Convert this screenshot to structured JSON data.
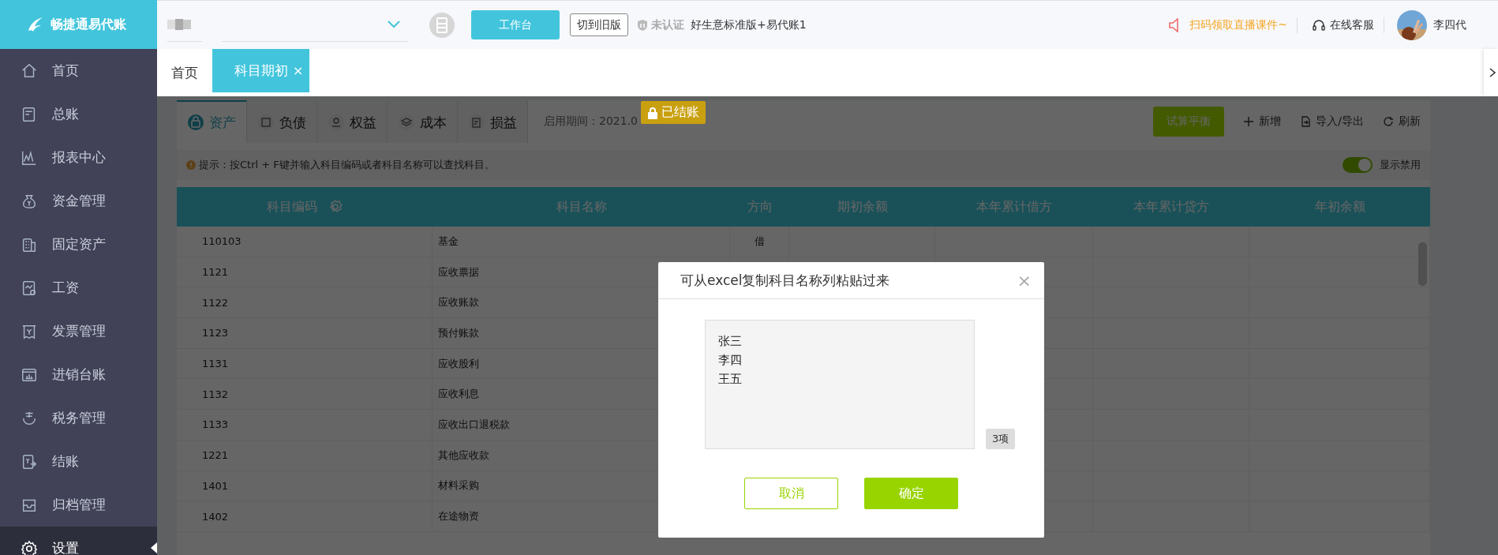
{
  "sidebar": {
    "logo": "畅捷通易代账",
    "items": [
      {
        "label": "首页",
        "selected": false
      },
      {
        "label": "总账",
        "selected": false
      },
      {
        "label": "报表中心",
        "selected": false
      },
      {
        "label": "资金管理",
        "selected": false
      },
      {
        "label": "固定资产",
        "selected": false
      },
      {
        "label": "工资",
        "selected": false
      },
      {
        "label": "发票管理",
        "selected": false
      },
      {
        "label": "进销台账",
        "selected": false
      },
      {
        "label": "税务管理",
        "selected": false
      },
      {
        "label": "结账",
        "selected": false
      },
      {
        "label": "归档管理",
        "selected": false
      },
      {
        "label": "设置",
        "selected": true
      }
    ]
  },
  "topbar": {
    "workbench_button": "工作台",
    "old_version_button": "切到旧版",
    "certification": "未认证",
    "product": "好生意标准版+易代账1",
    "promo": "扫码领取直播课件~",
    "support": "在线客服",
    "user": "李四代"
  },
  "page_tabs": [
    {
      "label": "首页",
      "selected": false
    },
    {
      "label": "科目期初",
      "selected": true,
      "close": "×"
    }
  ],
  "category_tabs": [
    {
      "label": "资产",
      "selected": true
    },
    {
      "label": "负债",
      "selected": false
    },
    {
      "label": "权益",
      "selected": false
    },
    {
      "label": "成本",
      "selected": false
    },
    {
      "label": "损益",
      "selected": false
    }
  ],
  "period": "启用期间：2021.0",
  "closed_badge": "已结账",
  "trial_balance_button": "试算平衡",
  "toolbar_actions": [
    {
      "label": "新增",
      "kind": "add"
    },
    {
      "label": "导入/导出",
      "kind": "import"
    },
    {
      "label": "刷新",
      "kind": "refresh"
    }
  ],
  "tip": "提示：按Ctrl + F键并输入科目编码或者科目名称可以查找科目。",
  "show_disabled": {
    "label": "显示禁用",
    "on": true
  },
  "table": {
    "columns": [
      "科目编码",
      "科目名称",
      "方向",
      "期初余额",
      "本年累计借方",
      "本年累计贷方",
      "年初余额"
    ],
    "rows": [
      {
        "code": "110103",
        "name": "基金",
        "direction": "借"
      },
      {
        "code": "1121",
        "name": "应收票据"
      },
      {
        "code": "1122",
        "name": "应收账款"
      },
      {
        "code": "1123",
        "name": "预付账款"
      },
      {
        "code": "1131",
        "name": "应收股利"
      },
      {
        "code": "1132",
        "name": "应收利息"
      },
      {
        "code": "1133",
        "name": "应收出口退税款"
      },
      {
        "code": "1221",
        "name": "其他应收款"
      },
      {
        "code": "1401",
        "name": "材料采购"
      },
      {
        "code": "1402",
        "name": "在途物资"
      }
    ]
  },
  "dialog": {
    "title": "可从excel复制科目名称列粘贴过来",
    "close": "×",
    "lines": [
      "张三",
      "李四",
      "王五"
    ],
    "count": "3项",
    "buttons": [
      {
        "label": "取消",
        "kind": "secondary"
      },
      {
        "label": "确定",
        "kind": "primary"
      }
    ]
  }
}
